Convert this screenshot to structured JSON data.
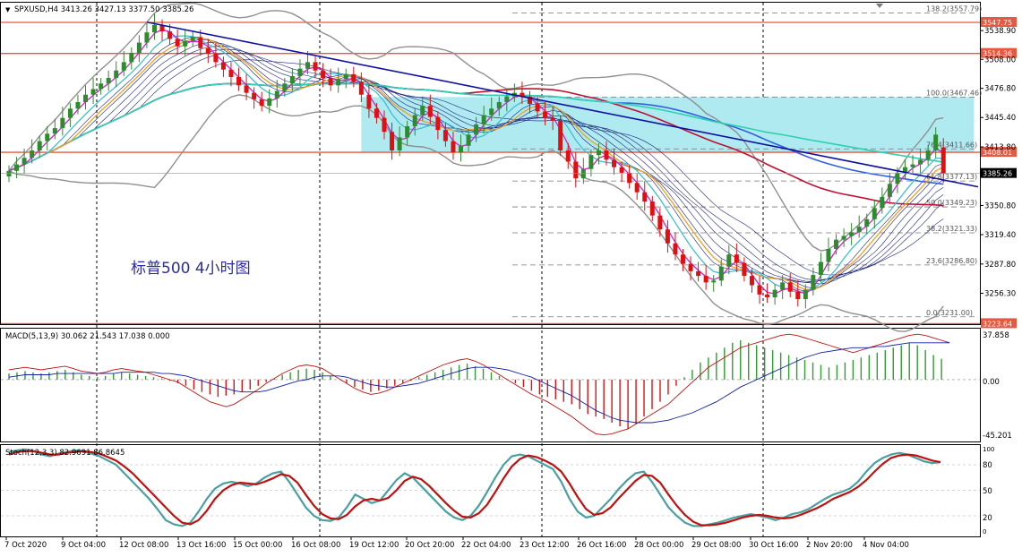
{
  "main_panel": {
    "symbol_header": "SPXUSD,H4  3413.26 3427.13 3377.50 3385.26",
    "watermark_text": "标普500  4小时图",
    "last_price_label": "3385.26"
  },
  "colors": {
    "bull_candle": "#2e8b2e",
    "bear_candle": "#e01010",
    "trendline": "#1010a0",
    "fib_zone": "#aeeaf0",
    "horizontal_levels": "#e8583f",
    "bollinger": "#909090",
    "ma_fast": "#d020d0",
    "ma_mid": "#3fbfcf",
    "ma_slow": "#f0a020",
    "ma_long_red": "#c01030",
    "ma_long_blue": "#3060e0",
    "ma_long_green": "#30d0b0",
    "macd_hist": "#2e9e2e",
    "macd_line": "#c01010",
    "macd_signal": "#1020a0",
    "stoch_k": "#4aa0a0",
    "stoch_d": "#c01010"
  },
  "chart_data": [
    {
      "type": "candlestick",
      "title": "SPXUSD,H4  3413.26 3427.13 3377.50 3385.26",
      "last": {
        "open": 3413.26,
        "high": 3427.13,
        "low": 3377.5,
        "close": 3385.26
      },
      "ylim": [
        3225.0,
        3568.0
      ],
      "y_tick_labels": [
        "3538.90",
        "3508.00",
        "3476.80",
        "3445.40",
        "3413.80",
        "3350.80",
        "3319.40",
        "3287.80",
        "3256.30"
      ],
      "x_tick_labels": [
        "7 Oct 2020",
        "9 Oct 04:00",
        "12 Oct 08:00",
        "13 Oct 16:00",
        "15 Oct 00:00",
        "16 Oct 08:00",
        "19 Oct 12:00",
        "20 Oct 20:00",
        "22 Oct 04:00",
        "23 Oct 12:00",
        "26 Oct 16:00",
        "28 Oct 00:00",
        "29 Oct 08:00",
        "30 Oct 16:00",
        "2 Nov 20:00",
        "4 Nov 04:00"
      ],
      "horizontal_levels": [
        {
          "label": "3547.75",
          "value": 3547.75
        },
        {
          "label": "3514.36",
          "value": 3514.36
        },
        {
          "label": "3408.01",
          "value": 3408.01
        },
        {
          "label": "3223.64",
          "value": 3223.64
        }
      ],
      "fibonacci_levels": [
        {
          "label": "138.2(3557.79)",
          "value": 3557.79
        },
        {
          "label": "100.0(3467.46)",
          "value": 3467.46
        },
        {
          "label": "76.4(3411.66)",
          "value": 3411.66
        },
        {
          "label": "61.8(3377.13)",
          "value": 3377.13
        },
        {
          "label": "50.0(3349.23)",
          "value": 3349.23
        },
        {
          "label": "38.2(3321.33)",
          "value": 3321.33
        },
        {
          "label": "23.6(3286.80)",
          "value": 3286.8
        },
        {
          "label": "0.0(3231.00)",
          "value": 3231.0
        }
      ],
      "trendline": {
        "start": {
          "bar": 18,
          "price": 3548
        },
        "end": {
          "bar": 124,
          "price": 3375
        }
      },
      "zone": {
        "from_bar": 46,
        "to_bar": 126,
        "top": 3467.46,
        "bottom": 3408.01
      },
      "closes": [
        3388,
        3395,
        3402,
        3410,
        3420,
        3428,
        3434,
        3445,
        3455,
        3462,
        3470,
        3476,
        3482,
        3488,
        3496,
        3505,
        3515,
        3526,
        3537,
        3545,
        3538,
        3530,
        3522,
        3528,
        3532,
        3520,
        3514,
        3505,
        3497,
        3489,
        3480,
        3472,
        3465,
        3458,
        3466,
        3474,
        3482,
        3490,
        3498,
        3505,
        3496,
        3488,
        3480,
        3487,
        3492,
        3484,
        3470,
        3455,
        3445,
        3430,
        3410,
        3424,
        3436,
        3448,
        3458,
        3446,
        3432,
        3420,
        3408,
        3415,
        3427,
        3438,
        3448,
        3455,
        3462,
        3468,
        3472,
        3468,
        3460,
        3452,
        3445,
        3442,
        3410,
        3398,
        3380,
        3390,
        3405,
        3410,
        3400,
        3392,
        3386,
        3375,
        3365,
        3355,
        3340,
        3325,
        3310,
        3298,
        3288,
        3280,
        3275,
        3268,
        3270,
        3285,
        3298,
        3289,
        3275,
        3265,
        3255,
        3252,
        3260,
        3268,
        3258,
        3250,
        3260,
        3276,
        3290,
        3304,
        3314,
        3318,
        3322,
        3328,
        3336,
        3348,
        3360,
        3374,
        3386,
        3392,
        3395,
        3400,
        3410,
        3427,
        3385
      ],
      "opens": [
        3382,
        3388,
        3395,
        3402,
        3410,
        3420,
        3428,
        3434,
        3445,
        3455,
        3462,
        3470,
        3476,
        3482,
        3488,
        3496,
        3505,
        3515,
        3526,
        3537,
        3545,
        3538,
        3530,
        3522,
        3528,
        3532,
        3520,
        3514,
        3505,
        3497,
        3489,
        3480,
        3472,
        3465,
        3458,
        3466,
        3474,
        3482,
        3490,
        3498,
        3505,
        3496,
        3488,
        3480,
        3487,
        3492,
        3484,
        3470,
        3455,
        3445,
        3430,
        3410,
        3424,
        3436,
        3448,
        3458,
        3446,
        3432,
        3420,
        3408,
        3415,
        3427,
        3438,
        3448,
        3455,
        3462,
        3468,
        3472,
        3468,
        3460,
        3452,
        3445,
        3442,
        3410,
        3398,
        3380,
        3390,
        3405,
        3410,
        3400,
        3392,
        3386,
        3375,
        3365,
        3355,
        3340,
        3325,
        3310,
        3298,
        3288,
        3280,
        3275,
        3268,
        3270,
        3285,
        3298,
        3289,
        3275,
        3265,
        3255,
        3252,
        3260,
        3268,
        3258,
        3250,
        3260,
        3276,
        3290,
        3304,
        3314,
        3318,
        3322,
        3328,
        3336,
        3348,
        3360,
        3374,
        3386,
        3392,
        3395,
        3400,
        3410,
        3413.26
      ]
    },
    {
      "type": "bar",
      "title": "MACD(5,13,9) 30.062 21.543 17.038 0.000",
      "ylim": [
        -45.201,
        37.858
      ],
      "y_tick_labels": [
        "37.858",
        "0.00",
        "-45.201"
      ],
      "series_names": [
        "histogram",
        "macd",
        "signal"
      ],
      "histogram": [
        5,
        6,
        7,
        6,
        5,
        6,
        7,
        8,
        6,
        4,
        3,
        2,
        3,
        5,
        6,
        5,
        4,
        3,
        2,
        1,
        -1,
        -3,
        -5,
        -8,
        -10,
        -12,
        -14,
        -13,
        -12,
        -10,
        -8,
        -5,
        -2,
        1,
        4,
        6,
        8,
        9,
        8,
        6,
        3,
        0,
        -3,
        -6,
        -8,
        -10,
        -9,
        -7,
        -5,
        -3,
        -1,
        2,
        4,
        6,
        8,
        10,
        12,
        13,
        11,
        9,
        6,
        3,
        0,
        -3,
        -6,
        -9,
        -12,
        -14,
        -16,
        -18,
        -20,
        -24,
        -28,
        -30,
        -32,
        -35,
        -38,
        -40,
        -36,
        -30,
        -24,
        -18,
        -12,
        -5,
        2,
        8,
        14,
        18,
        22,
        26,
        30,
        32,
        30,
        28,
        26,
        24,
        22,
        20,
        18,
        16,
        14,
        12,
        10,
        12,
        14,
        16,
        18,
        20,
        22,
        24,
        26,
        28,
        30,
        28,
        24,
        20,
        17
      ],
      "macd": [
        8,
        9,
        10,
        9,
        8,
        9,
        10,
        11,
        9,
        7,
        6,
        5,
        6,
        8,
        9,
        8,
        7,
        6,
        4,
        2,
        0,
        -2,
        -6,
        -10,
        -14,
        -18,
        -20,
        -22,
        -20,
        -16,
        -12,
        -8,
        -3,
        1,
        5,
        8,
        11,
        12,
        11,
        9,
        5,
        1,
        -3,
        -7,
        -10,
        -12,
        -11,
        -9,
        -6,
        -3,
        0,
        3,
        6,
        9,
        12,
        14,
        16,
        17,
        15,
        12,
        8,
        4,
        0,
        -4,
        -8,
        -12,
        -15,
        -18,
        -22,
        -26,
        -30,
        -35,
        -40,
        -44,
        -45,
        -44,
        -42,
        -40,
        -36,
        -32,
        -28,
        -24,
        -20,
        -14,
        -8,
        -2,
        4,
        10,
        14,
        18,
        22,
        26,
        28,
        30,
        32,
        34,
        36,
        37,
        36,
        34,
        32,
        30,
        28,
        26,
        24,
        22,
        24,
        26,
        28,
        30,
        32,
        34,
        36,
        37,
        36,
        34,
        32,
        30
      ],
      "signal": [
        2,
        3,
        4,
        4,
        4,
        4,
        5,
        5,
        5,
        5,
        5,
        5,
        5,
        5,
        6,
        6,
        6,
        6,
        6,
        5,
        5,
        4,
        3,
        1,
        -1,
        -3,
        -5,
        -7,
        -9,
        -10,
        -10,
        -10,
        -9,
        -7,
        -5,
        -3,
        -1,
        0,
        2,
        3,
        3,
        3,
        2,
        0,
        -2,
        -4,
        -5,
        -6,
        -6,
        -5,
        -4,
        -3,
        -1,
        1,
        3,
        5,
        7,
        9,
        10,
        10,
        10,
        9,
        8,
        6,
        4,
        2,
        -1,
        -4,
        -7,
        -10,
        -13,
        -17,
        -21,
        -25,
        -28,
        -31,
        -33,
        -34,
        -35,
        -35,
        -35,
        -34,
        -33,
        -31,
        -29,
        -27,
        -24,
        -21,
        -18,
        -14,
        -10,
        -6,
        -3,
        0,
        3,
        6,
        9,
        12,
        15,
        18,
        20,
        22,
        23,
        24,
        25,
        26,
        26,
        26,
        27,
        27,
        28,
        29,
        30,
        30,
        30,
        30,
        30,
        30
      ]
    },
    {
      "type": "line",
      "title": "Stoch(12,3,3) 82.9691 86.8645",
      "ylim": [
        0,
        100
      ],
      "y_tick_labels": [
        "100",
        "80",
        "50",
        "20",
        "0"
      ],
      "series": [
        {
          "name": "%K",
          "values": [
            95,
            97,
            98,
            96,
            92,
            90,
            93,
            95,
            97,
            96,
            93,
            90,
            85,
            80,
            70,
            60,
            50,
            40,
            28,
            15,
            10,
            8,
            12,
            25,
            40,
            52,
            58,
            60,
            58,
            55,
            58,
            65,
            70,
            72,
            60,
            45,
            30,
            20,
            15,
            14,
            18,
            30,
            45,
            40,
            35,
            38,
            50,
            62,
            70,
            65,
            55,
            45,
            35,
            25,
            18,
            15,
            20,
            32,
            48,
            65,
            80,
            90,
            92,
            90,
            85,
            80,
            75,
            60,
            40,
            25,
            18,
            20,
            30,
            40,
            52,
            62,
            70,
            72,
            60,
            45,
            30,
            20,
            12,
            8,
            8,
            10,
            12,
            15,
            18,
            20,
            22,
            20,
            18,
            15,
            18,
            22,
            24,
            28,
            34,
            40,
            45,
            48,
            52,
            60,
            72,
            82,
            88,
            92,
            94,
            92,
            88,
            84,
            82,
            83
          ]
        },
        {
          "name": "%D",
          "values": [
            92,
            95,
            96,
            96,
            94,
            92,
            92,
            94,
            95,
            96,
            95,
            93,
            89,
            85,
            78,
            70,
            60,
            50,
            40,
            30,
            20,
            12,
            10,
            15,
            26,
            40,
            50,
            56,
            59,
            58,
            57,
            60,
            64,
            69,
            67,
            59,
            45,
            32,
            22,
            17,
            16,
            21,
            31,
            38,
            40,
            38,
            41,
            50,
            61,
            66,
            63,
            55,
            45,
            35,
            26,
            19,
            18,
            23,
            33,
            48,
            64,
            78,
            87,
            91,
            89,
            85,
            80,
            72,
            58,
            42,
            28,
            21,
            23,
            30,
            41,
            51,
            61,
            68,
            67,
            59,
            45,
            32,
            21,
            13,
            9,
            9,
            10,
            12,
            15,
            18,
            20,
            21,
            20,
            18,
            17,
            18,
            21,
            25,
            29,
            34,
            40,
            44,
            48,
            54,
            62,
            72,
            81,
            88,
            91,
            92,
            91,
            88,
            85,
            83
          ]
        }
      ]
    }
  ],
  "macd_panel": {
    "label": "MACD(5,13,9) 30.062 21.543 17.038 0.000",
    "top_label": "37.858",
    "zero_label": "0.00",
    "bottom_label": "-45.201"
  },
  "stoch_panel": {
    "label": "Stoch(12,3,3) 82.9691 86.8645",
    "tick_100": "100",
    "tick_80": "80",
    "tick_50": "50",
    "tick_20": "20",
    "tick_0": "0"
  }
}
